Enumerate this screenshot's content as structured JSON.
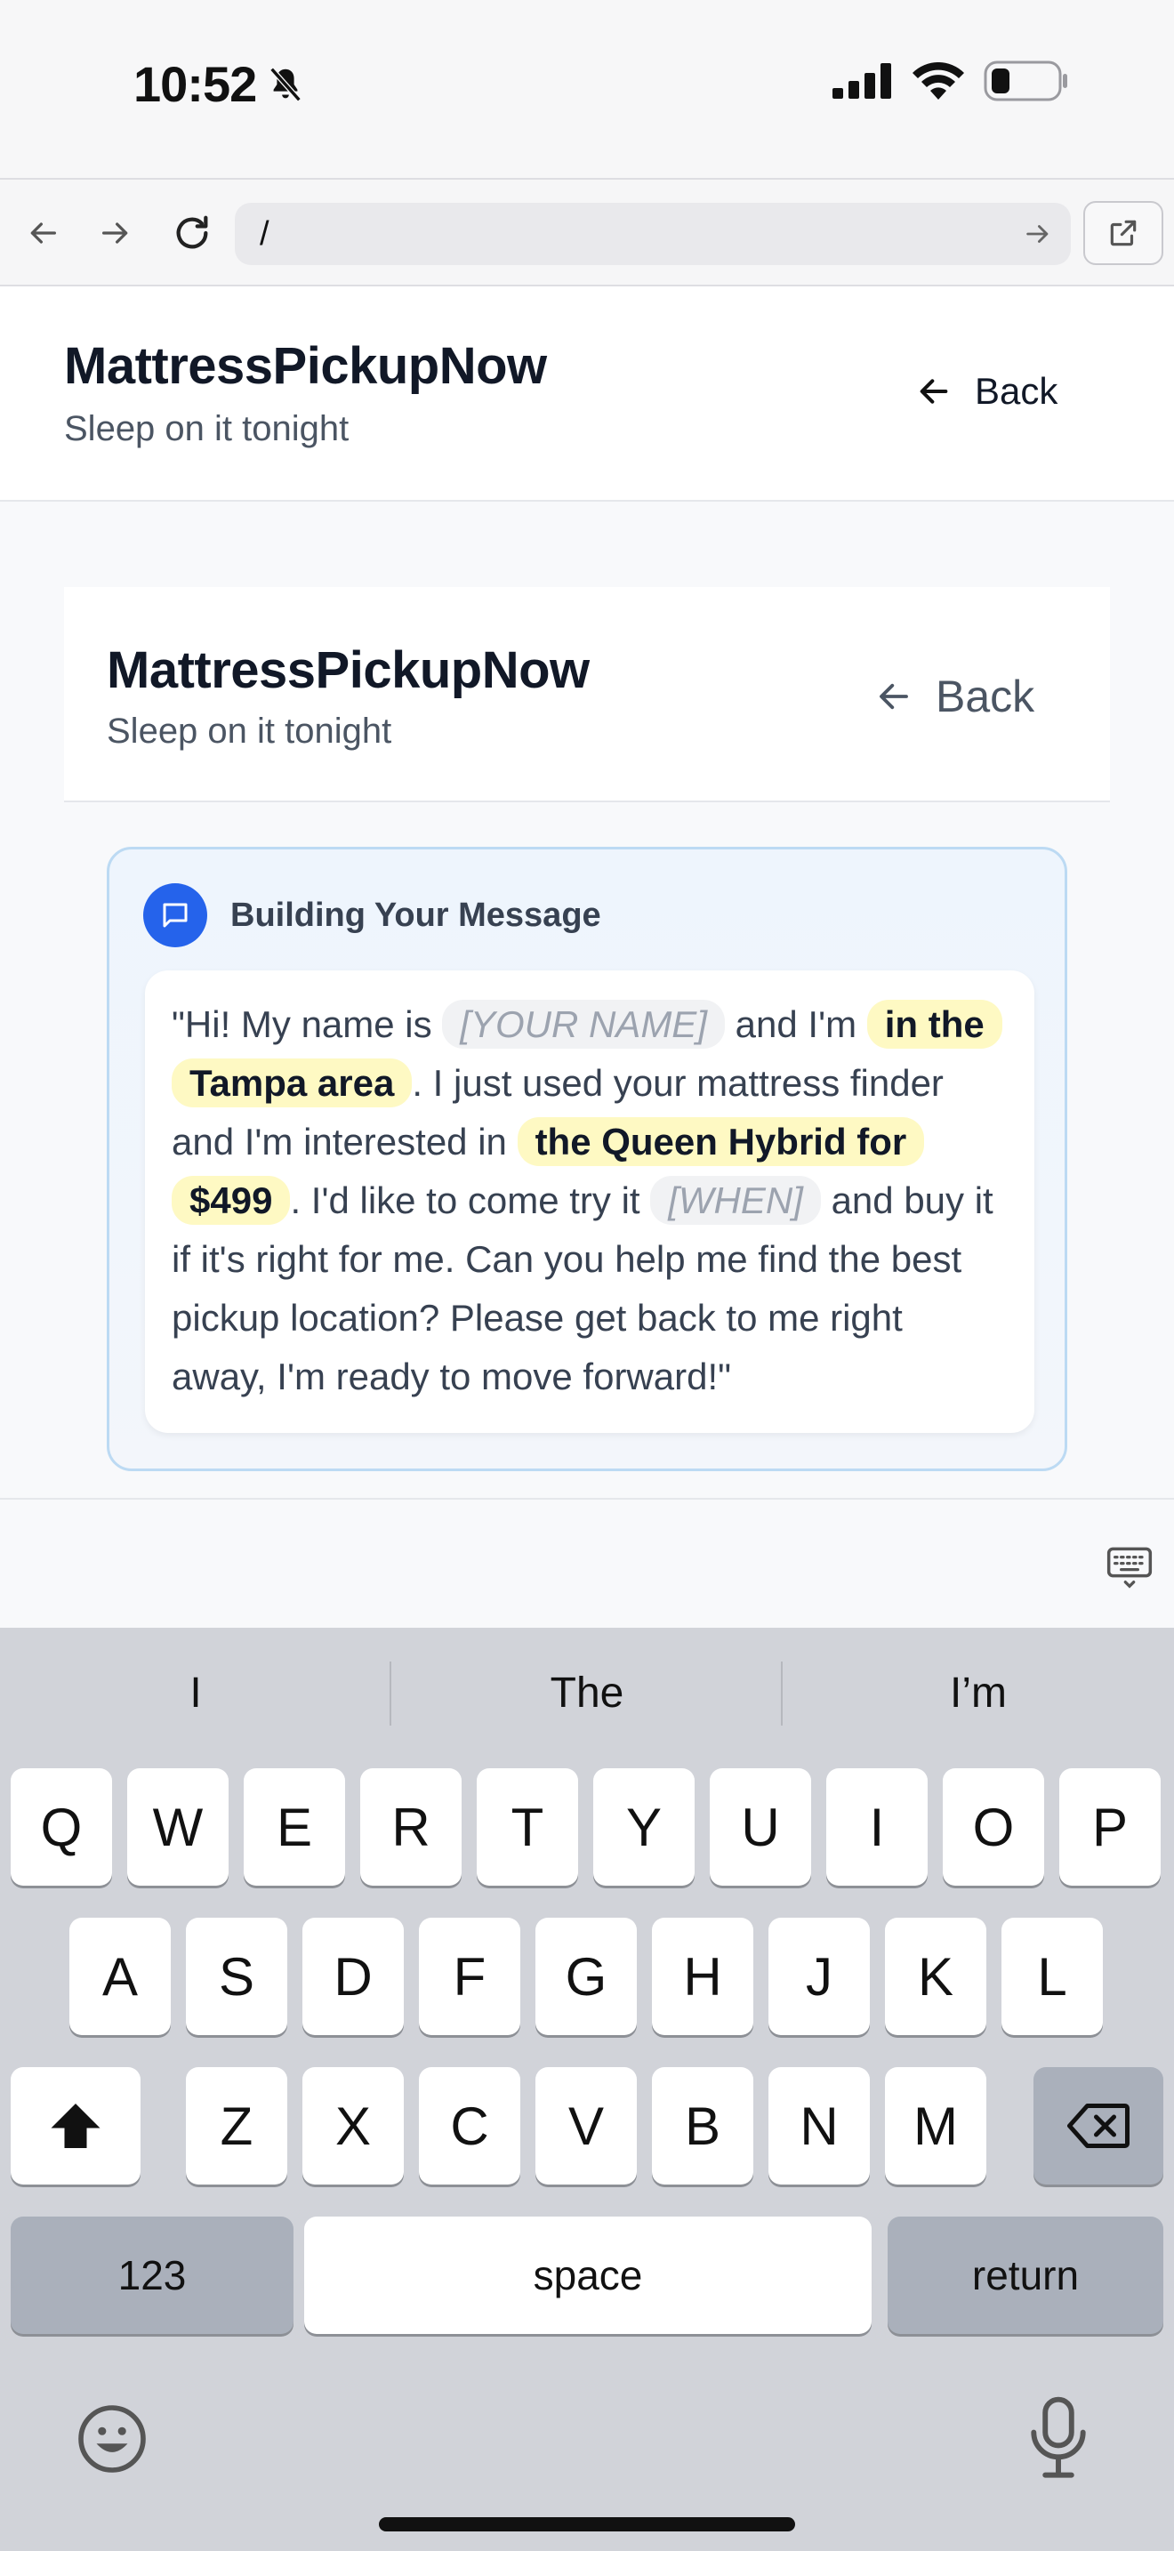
{
  "status": {
    "time": "10:52"
  },
  "browser": {
    "url": "/"
  },
  "header": {
    "title": "MattressPickupNow",
    "subtitle": "Sleep on it tonight",
    "back_label": "Back"
  },
  "inner": {
    "title": "MattressPickupNow",
    "subtitle": "Sleep on it tonight",
    "back_label": "Back"
  },
  "message": {
    "heading": "Building Your Message",
    "parts": {
      "p1": "\"Hi! My name is ",
      "name_placeholder": "[YOUR NAME]",
      "p2": " and I'm ",
      "location": "in the Tampa area",
      "p3": ". I just used your mattress finder and I'm interested in ",
      "product": "the Queen Hybrid for $499",
      "p4": ". I'd like to come try it ",
      "when_placeholder": "[WHEN]",
      "p5": " and buy it if it's right for me. Can you help me find the best pickup location? Please get back to me right away, I'm ready to move forward!\""
    }
  },
  "keyboard": {
    "suggestions": [
      "I",
      "The",
      "I’m"
    ],
    "row1": [
      "Q",
      "W",
      "E",
      "R",
      "T",
      "Y",
      "U",
      "I",
      "O",
      "P"
    ],
    "row2": [
      "A",
      "S",
      "D",
      "F",
      "G",
      "H",
      "J",
      "K",
      "L"
    ],
    "row3": [
      "Z",
      "X",
      "C",
      "V",
      "B",
      "N",
      "M"
    ],
    "numbers_label": "123",
    "space_label": "space",
    "return_label": "return"
  },
  "icons": {
    "bell": "bell-slash-icon",
    "signal": "signal-icon",
    "wifi": "wifi-icon",
    "battery": "battery-icon",
    "chat": "chat-bubble-icon",
    "emoji": "emoji-icon",
    "mic": "microphone-icon"
  },
  "colors": {
    "accent": "#2563eb",
    "highlight": "#fef9c3",
    "border": "#bcdaf3"
  }
}
